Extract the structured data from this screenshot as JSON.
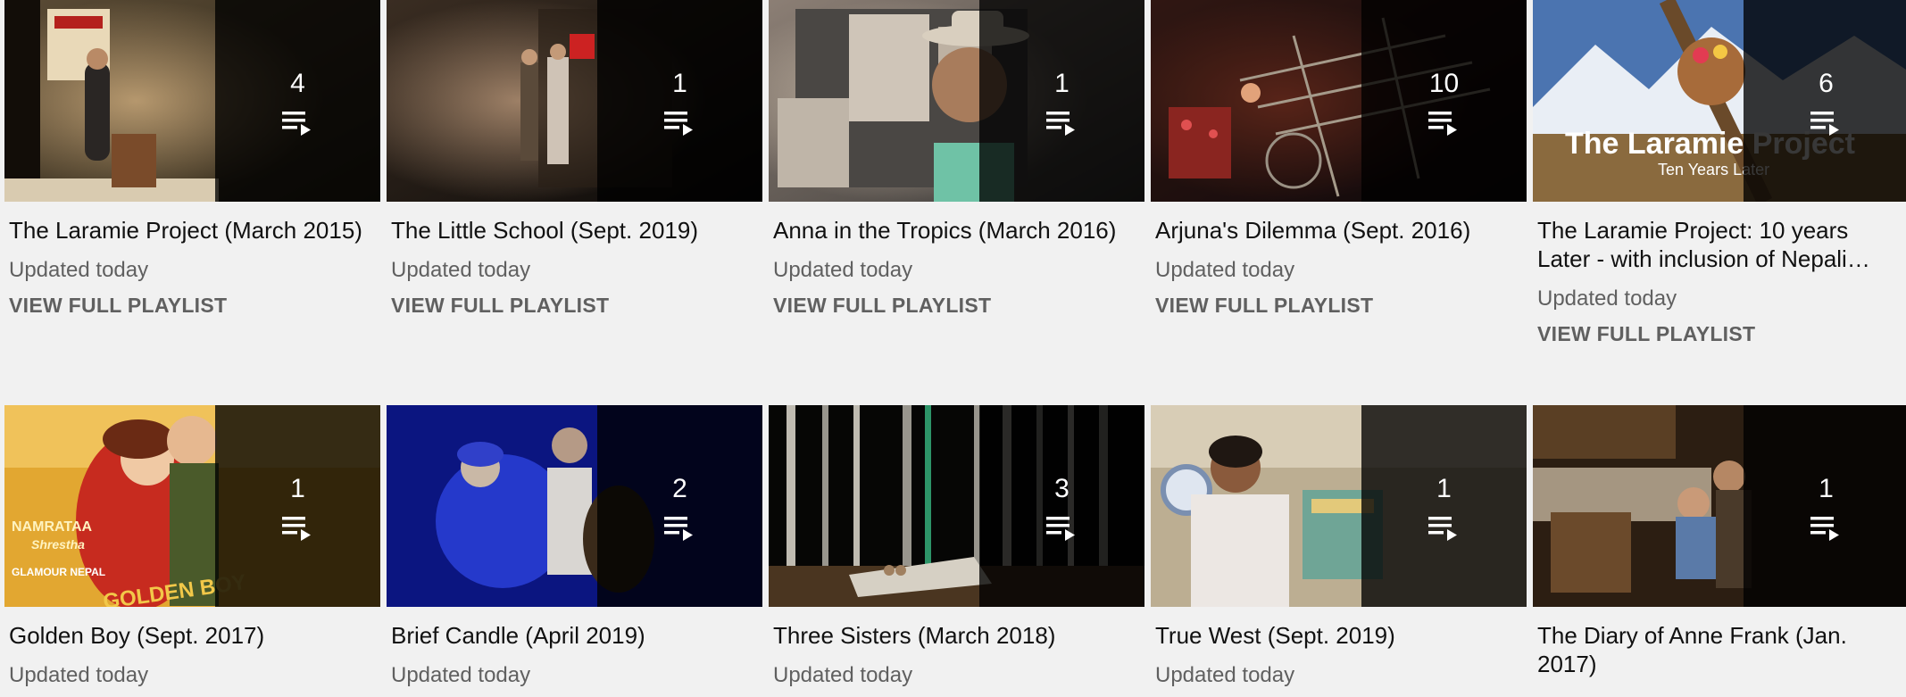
{
  "playlists": [
    {
      "title": "The Laramie Project (March 2015)",
      "count": "4",
      "updated": "Updated today",
      "view_full": "VIEW FULL PLAYLIST",
      "thumbnail_colors": [
        "#2b2416",
        "#5a4b35",
        "#c9a87a"
      ]
    },
    {
      "title": "The Little School (Sept. 2019)",
      "count": "1",
      "updated": "Updated today",
      "view_full": "VIEW FULL PLAYLIST",
      "thumbnail_colors": [
        "#0b0908",
        "#3a2d22",
        "#b29174"
      ]
    },
    {
      "title": "Anna in the Tropics (March 2016)",
      "count": "1",
      "updated": "Updated today",
      "view_full": "VIEW FULL PLAYLIST",
      "thumbnail_colors": [
        "#3b3937",
        "#8c7f75",
        "#d9c9b5"
      ]
    },
    {
      "title": "Arjuna's Dilemma (Sept. 2016)",
      "count": "10",
      "updated": "Updated today",
      "view_full": "VIEW FULL PLAYLIST",
      "thumbnail_colors": [
        "#120b0d",
        "#5c2a1e",
        "#c94f2f"
      ]
    },
    {
      "title": "The Laramie Project: 10 years Later - with inclusion of Nepali…",
      "count": "6",
      "updated": "Updated today",
      "view_full": "VIEW FULL PLAYLIST",
      "thumbnail_colors": [
        "#3a5d93",
        "#9aa8be",
        "#7a5a36"
      ],
      "thumbnail_text": {
        "main": "The Laramie Project",
        "sub": "Ten Years Later"
      }
    },
    {
      "title": "Golden Boy (Sept. 2017)",
      "count": "1",
      "updated": "Updated today",
      "view_full": "",
      "thumbnail_colors": [
        "#e0a331",
        "#c6571f",
        "#4a3a2a"
      ],
      "thumbnail_text": {
        "line1": "NAMRATAA",
        "line2": "Shrestha",
        "bottom": "GOLDEN BOY",
        "brand": "GLAMOUR NEPAL"
      }
    },
    {
      "title": "Brief Candle (April 2019)",
      "count": "2",
      "updated": "Updated today",
      "view_full": "",
      "thumbnail_colors": [
        "#0e1a8a",
        "#2739d6",
        "#c9b8a6"
      ]
    },
    {
      "title": "Three Sisters (March 2018)",
      "count": "3",
      "updated": "Updated today",
      "view_full": "",
      "thumbnail_colors": [
        "#080807",
        "#2e6a52",
        "#b9b1a1"
      ]
    },
    {
      "title": "True West (Sept. 2019)",
      "count": "1",
      "updated": "Updated today",
      "view_full": "",
      "thumbnail_colors": [
        "#b5ab93",
        "#6fa095",
        "#e9e3dc"
      ]
    },
    {
      "title": "The Diary of Anne Frank (Jan. 2017)",
      "count": "1",
      "updated": "",
      "view_full": "",
      "thumbnail_colors": [
        "#3a2a1a",
        "#7a5a38",
        "#c9a27a"
      ]
    }
  ],
  "icons": {
    "playlist": "playlist-play-icon"
  }
}
